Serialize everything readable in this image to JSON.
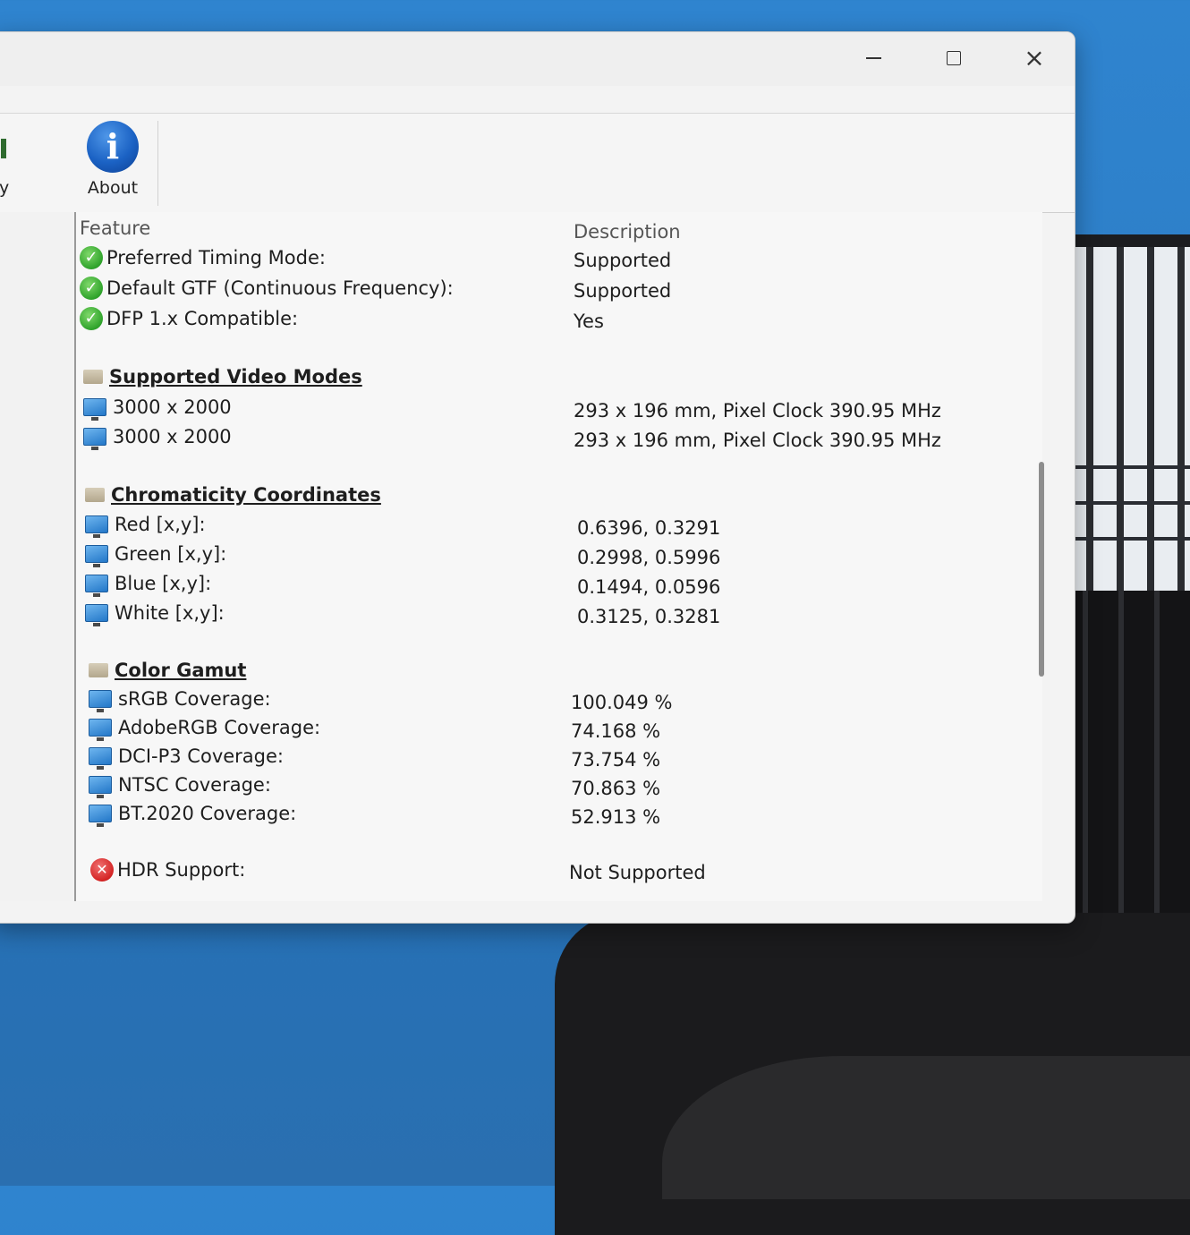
{
  "window": {
    "controls": {
      "minimize": "minimize",
      "maximize": "maximize",
      "close": "×"
    }
  },
  "toolbar": {
    "prev_label": "y",
    "about": {
      "icon_glyph": "i",
      "label": "About"
    }
  },
  "table": {
    "headers": {
      "feature": "Feature",
      "description": "Description"
    },
    "features": [
      {
        "label": "Preferred Timing Mode:",
        "value": "Supported",
        "icon": "check-circle-icon"
      },
      {
        "label": "Default GTF (Continuous Frequency):",
        "value": "Supported",
        "icon": "check-circle-icon"
      },
      {
        "label": "DFP 1.x Compatible:",
        "value": "Yes",
        "icon": "check-circle-icon"
      }
    ],
    "video_modes": {
      "title": "Supported Video Modes",
      "items": [
        {
          "label": "3000 x 2000",
          "value": "293 x 196 mm, Pixel Clock 390.95 MHz"
        },
        {
          "label": "3000 x 2000",
          "value": "293 x 196 mm, Pixel Clock 390.95 MHz"
        }
      ]
    },
    "chromaticity": {
      "title": "Chromaticity Coordinates",
      "items": [
        {
          "label": "Red [x,y]:",
          "value": "0.6396, 0.3291"
        },
        {
          "label": "Green [x,y]:",
          "value": "0.2998, 0.5996"
        },
        {
          "label": "Blue [x,y]:",
          "value": "0.1494, 0.0596"
        },
        {
          "label": "White [x,y]:",
          "value": "0.3125, 0.3281"
        }
      ]
    },
    "gamut": {
      "title": "Color Gamut",
      "items": [
        {
          "label": "sRGB Coverage:",
          "value": "100.049 %"
        },
        {
          "label": "AdobeRGB Coverage:",
          "value": "74.168 %"
        },
        {
          "label": "DCI-P3 Coverage:",
          "value": "73.754 %"
        },
        {
          "label": "NTSC Coverage:",
          "value": "70.863 %"
        },
        {
          "label": "BT.2020 Coverage:",
          "value": "52.913 %"
        }
      ]
    },
    "hdr": {
      "label": "HDR Support:",
      "value": "Not Supported",
      "icon": "x-circle-icon"
    }
  },
  "colors": {
    "accent": "#1b62c4",
    "ok": "#2fa32b",
    "error": "#d42424",
    "desktop": "#2d7cc4"
  }
}
